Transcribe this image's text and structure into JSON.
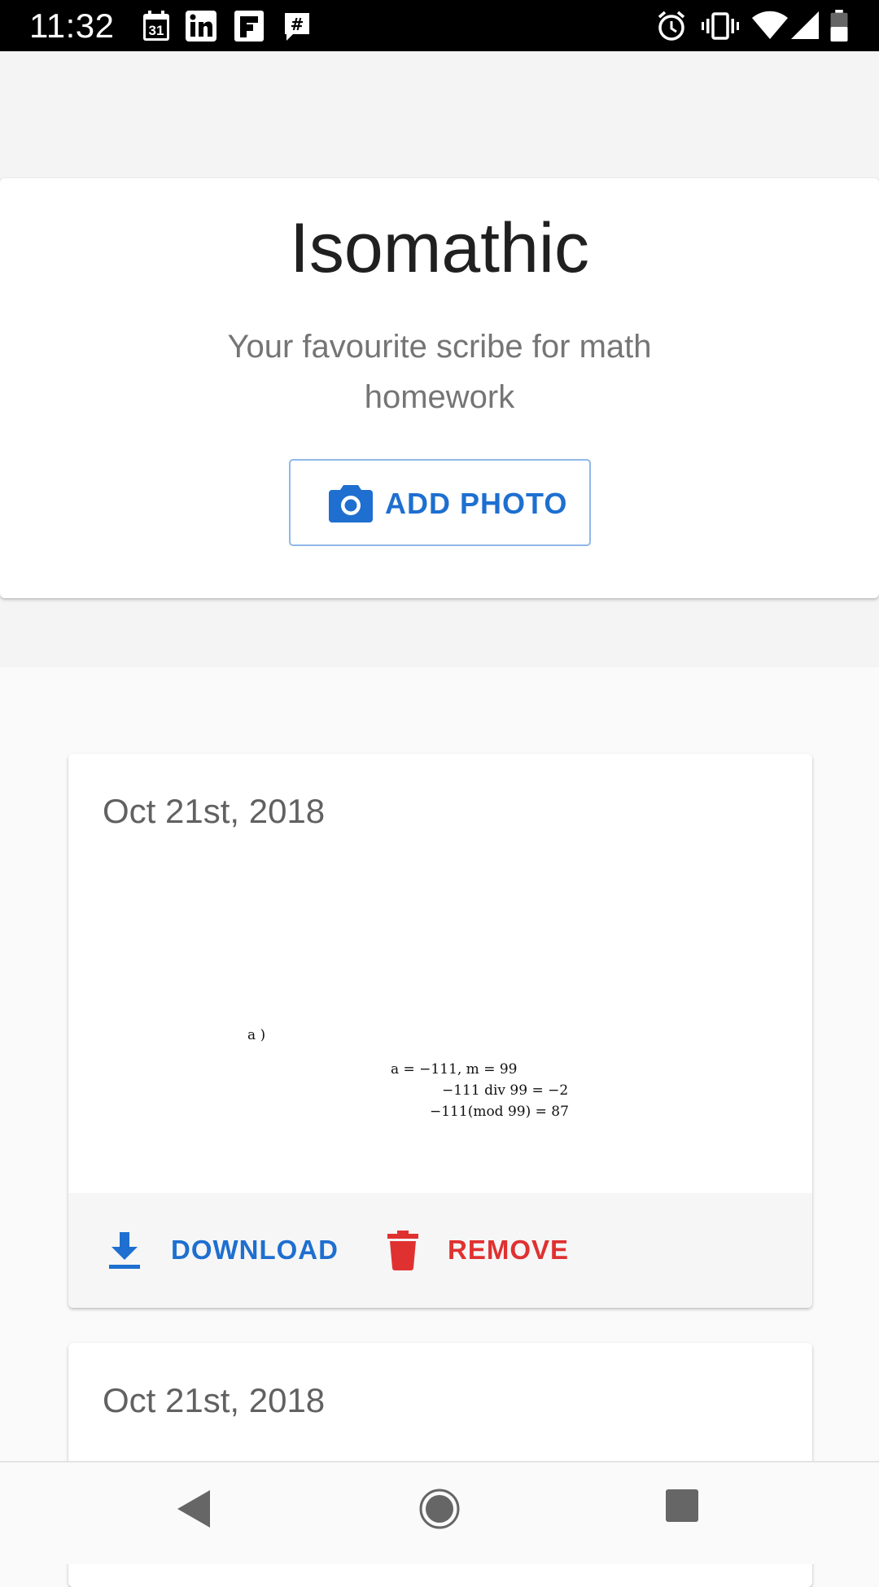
{
  "status_bar": {
    "time": "11:32",
    "notification_icons": [
      "calendar-icon",
      "linkedin-icon",
      "flipboard-icon",
      "slack-icon"
    ],
    "calendar_day": "31",
    "system_icons": [
      "alarm-icon",
      "vibrate-icon",
      "wifi-icon",
      "signal-icon",
      "battery-icon"
    ]
  },
  "hero": {
    "title": "Isomathic",
    "subtitle": "Your favourite scribe for math homework",
    "add_photo_label": "ADD PHOTO"
  },
  "entries": [
    {
      "date": "Oct 21st, 2018",
      "math": {
        "label": "a )",
        "lines": [
          "a = −111,    m = 99",
          "−111 div 99 = −2",
          "−111(mod 99) = 87"
        ]
      },
      "download_label": "DOWNLOAD",
      "remove_label": "REMOVE"
    },
    {
      "date": "Oct 21st, 2018"
    }
  ],
  "colors": {
    "accent": "#1e6fd0",
    "danger": "#e03131",
    "title": "#202020",
    "subtitle": "#757575"
  },
  "nav_bar": {
    "icons": [
      "back-icon",
      "home-icon",
      "recents-icon"
    ]
  }
}
